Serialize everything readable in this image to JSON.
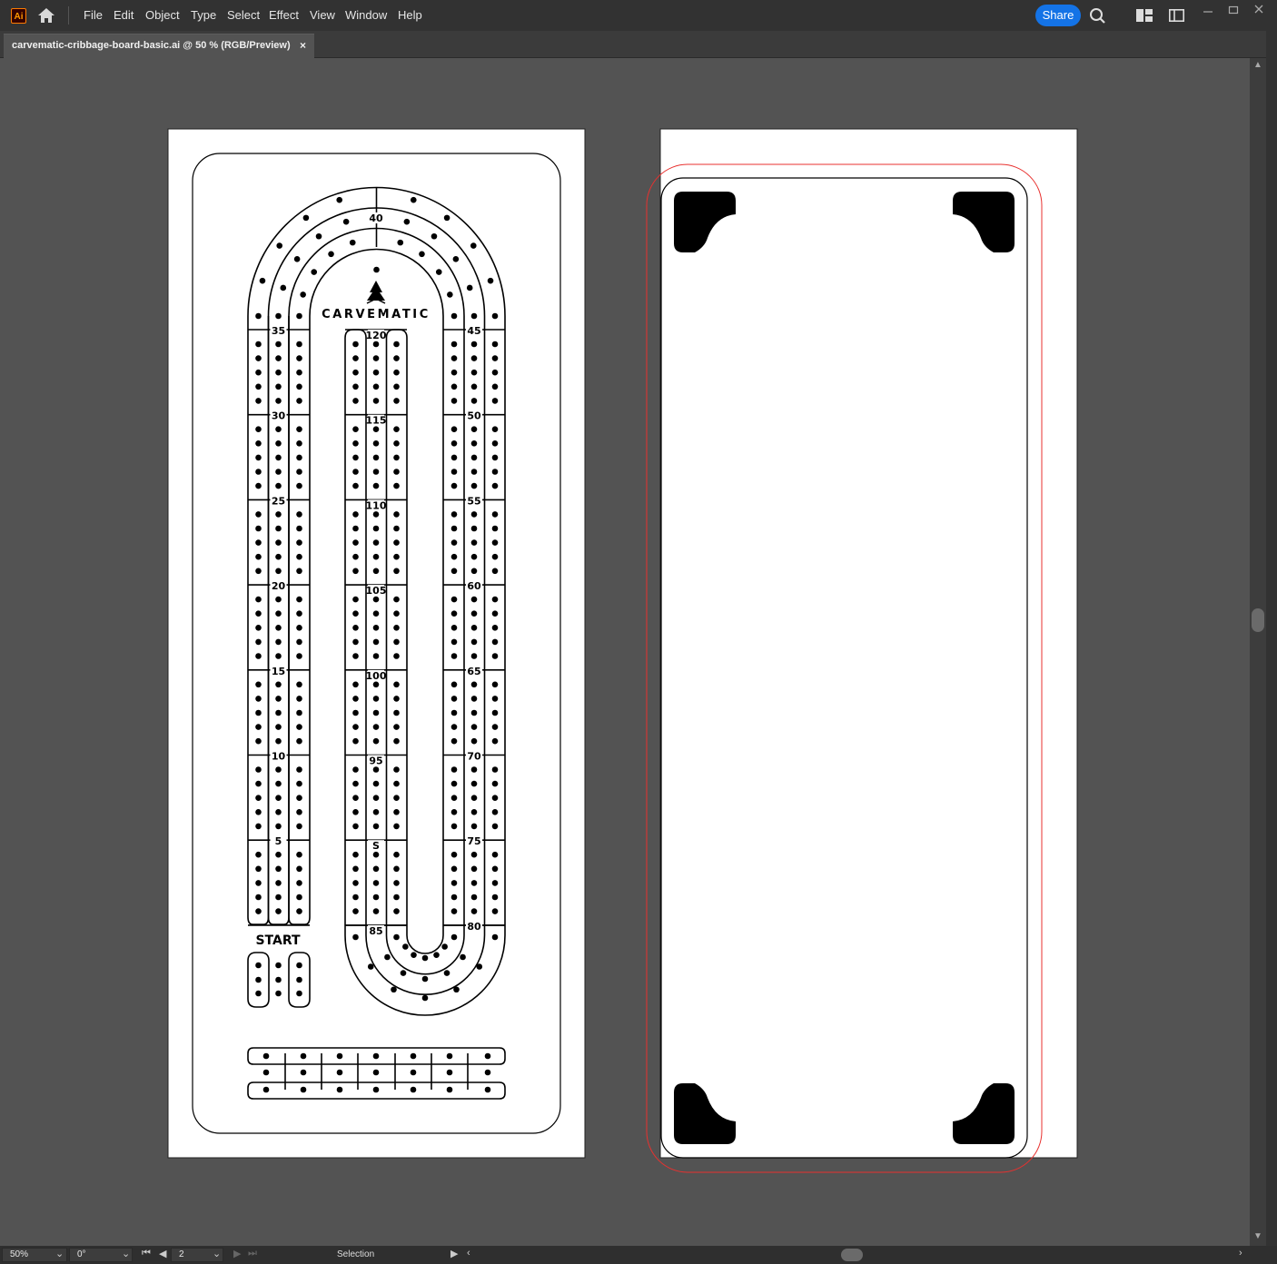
{
  "app": {
    "logo_text": "Ai",
    "accent": "#ff9a00"
  },
  "menu": {
    "items": [
      "File",
      "Edit",
      "Object",
      "Type",
      "Select",
      "Effect",
      "View",
      "Window",
      "Help"
    ],
    "share_label": "Share",
    "share_color": "#1473e6"
  },
  "document_tab": {
    "title": "carvematic-cribbage-board-basic.ai @ 50 % (RGB/Preview)",
    "close_label": "×"
  },
  "board": {
    "brand": "CARVEMATIC",
    "start_label": "START",
    "left_numbers": [
      "35",
      "30",
      "25",
      "20",
      "15",
      "10",
      "5"
    ],
    "top_number": "40",
    "middle_numbers": [
      "120",
      "115",
      "110",
      "105",
      "100",
      "95",
      "S",
      "85"
    ],
    "right_numbers": [
      "45",
      "50",
      "55",
      "60",
      "65",
      "70",
      "75",
      "80"
    ],
    "bleed_color": "#e8312f"
  },
  "status": {
    "zoom": "50%",
    "rotation": "0°",
    "artboard": "2",
    "tool": "Selection"
  }
}
